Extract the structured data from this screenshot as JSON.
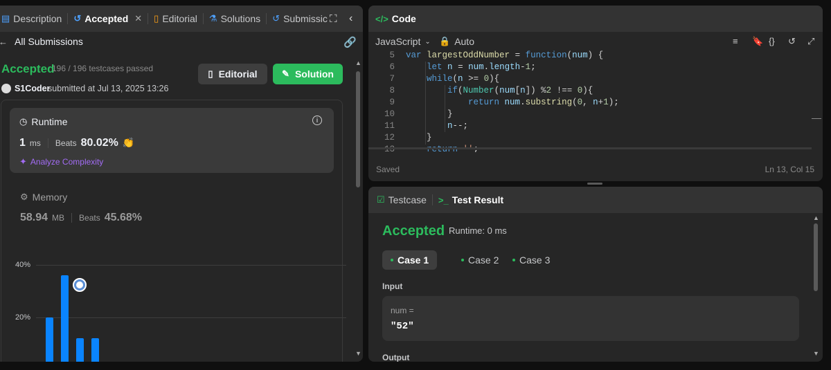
{
  "left_tabs": [
    {
      "label": "Description"
    },
    {
      "label": "Accepted"
    },
    {
      "label": "Editorial"
    },
    {
      "label": "Solutions"
    },
    {
      "label": "Submissic"
    }
  ],
  "back_label": "All Submissions",
  "status": {
    "label": "Accepted",
    "testcases": "196 / 196 testcases passed"
  },
  "user": {
    "name": "S1Coder",
    "submitted": "submitted at Jul 13, 2025 13:26"
  },
  "buttons": {
    "editorial": "Editorial",
    "solution": "Solution"
  },
  "runtime": {
    "title": "Runtime",
    "value": "1",
    "unit": "ms",
    "beats_label": "Beats",
    "beats": "80.02%",
    "analyze": "Analyze Complexity"
  },
  "memory": {
    "title": "Memory",
    "value": "58.94",
    "unit": "MB",
    "beats_label": "Beats",
    "beats": "45.68%"
  },
  "chart_data": {
    "type": "bar",
    "ticks": [
      "40%",
      "20%"
    ],
    "ylim": [
      0,
      40
    ],
    "values": [
      20,
      36,
      12,
      12,
      0.5,
      0.2,
      0.2,
      0.2,
      0.2,
      0.2,
      0.2,
      0.2,
      0.2,
      0.2,
      0.2,
      0.2,
      0.2,
      0.2
    ]
  },
  "code_panel": {
    "title": "Code",
    "language": "JavaScript",
    "mode": "Auto",
    "saved": "Saved",
    "position": "Ln 13, Col 15",
    "lines": [
      {
        "n": "5",
        "text": "var largestOddNumber = function(num) {"
      },
      {
        "n": "6",
        "text": "    let n = num.length-1;"
      },
      {
        "n": "7",
        "text": "    while(n >= 0){"
      },
      {
        "n": "8",
        "text": "        if(Number(num[n]) %2 !== 0){"
      },
      {
        "n": "9",
        "text": "            return num.substring(0, n+1);"
      },
      {
        "n": "10",
        "text": "        }"
      },
      {
        "n": "11",
        "text": "        n--;"
      },
      {
        "n": "12",
        "text": "    }"
      },
      {
        "n": "13",
        "text": "    return '';"
      }
    ]
  },
  "result_panel": {
    "tab_testcase": "Testcase",
    "tab_result": "Test Result",
    "status": "Accepted",
    "runtime": "Runtime: 0 ms",
    "cases": [
      "Case 1",
      "Case 2",
      "Case 3"
    ],
    "input_label": "Input",
    "var_name": "num =",
    "var_value": "\"52\"",
    "output_label": "Output"
  },
  "colors": {
    "accent_green": "#2cbb5d",
    "bar_blue": "#0a84ff",
    "purple": "#a36cf5"
  }
}
